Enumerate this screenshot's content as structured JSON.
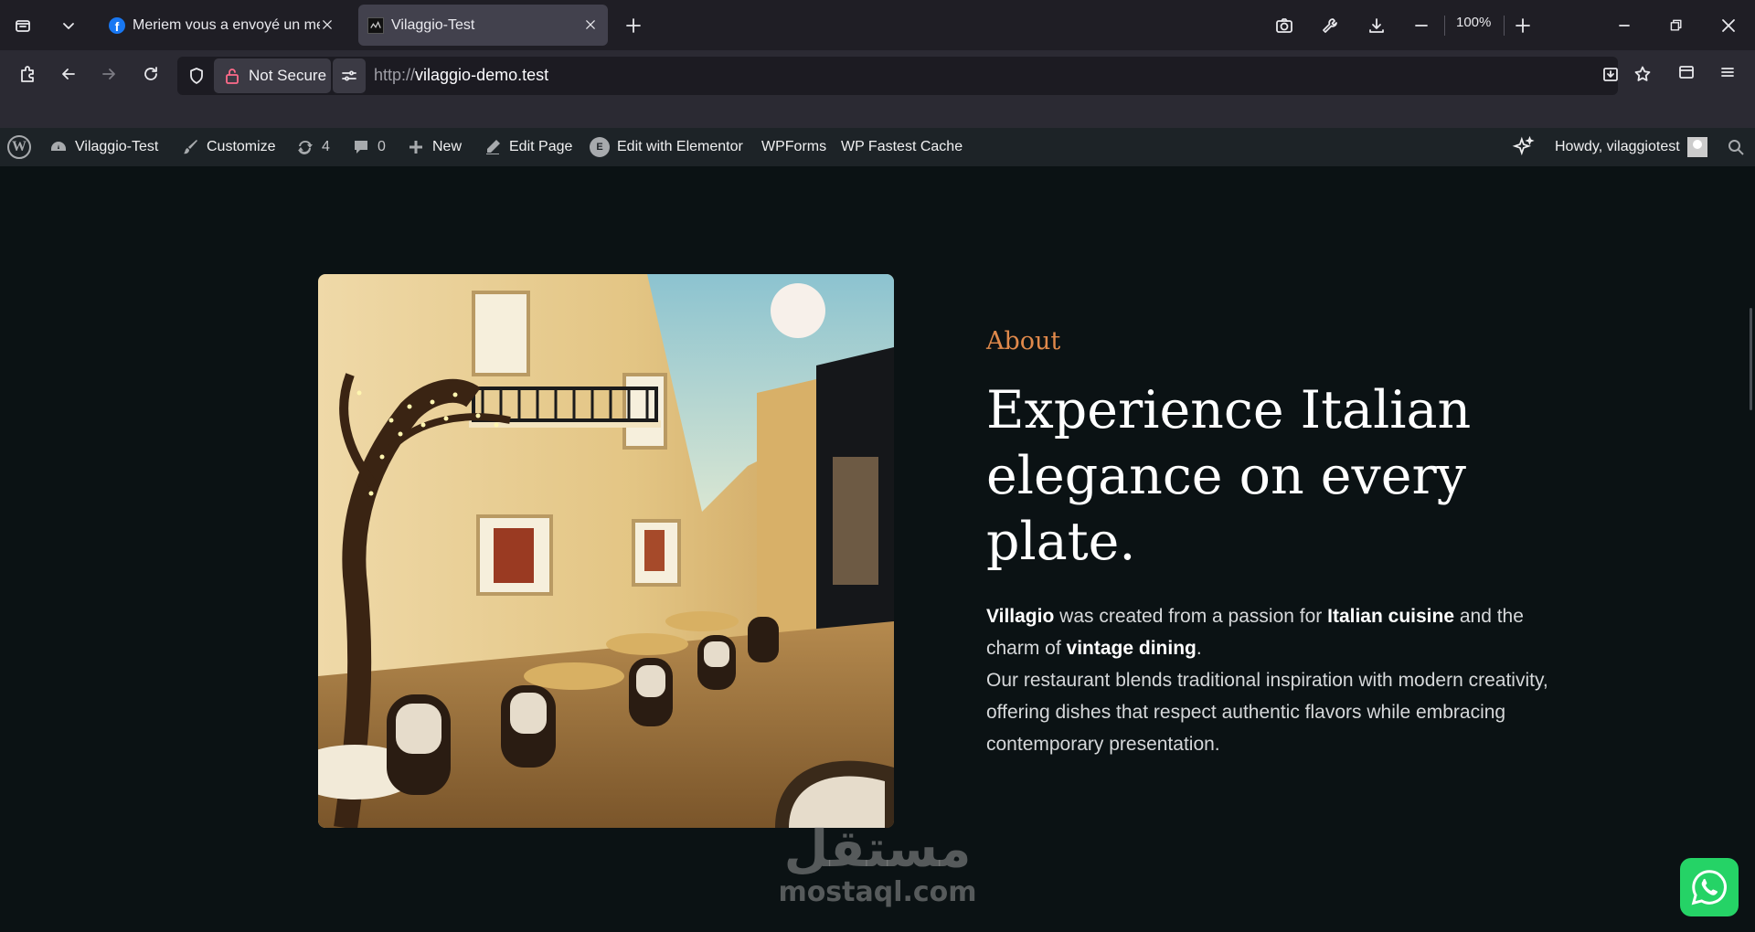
{
  "browser": {
    "tabs": [
      {
        "title": "Meriem vous a envoyé un mess",
        "favicon": "facebook-icon",
        "active": false
      },
      {
        "title": "Vilaggio-Test",
        "favicon": "site-icon",
        "active": true
      }
    ],
    "zoom": "100%",
    "security_label": "Not Secure",
    "url_scheme": "http://",
    "url_host": "vilaggio-demo.test"
  },
  "adminbar": {
    "site_name": "Vilaggio-Test",
    "customize": "Customize",
    "updates_count": "4",
    "comments_count": "0",
    "new": "New",
    "edit_page": "Edit Page",
    "edit_elementor": "Edit with Elementor",
    "wpforms": "WPForms",
    "cache": "WP Fastest Cache",
    "howdy": "Howdy, vilaggiotest"
  },
  "about": {
    "eyebrow": "About",
    "headline": "Experience Italian elegance on every plate.",
    "p1_brand": "Villagio",
    "p1_a": " was created from a passion for ",
    "p1_cuisine": "Italian cuisine",
    "p1_b": " and the charm of ",
    "p1_vintage": "vintage dining",
    "p1_end": ".",
    "p2": "Our restaurant blends traditional inspiration with modern creativity, offering dishes that respect authentic flavors while embracing contemporary presentation."
  },
  "watermark": {
    "arabic": "مستقل",
    "latin": "mostaql.com"
  },
  "colors": {
    "accent": "#e0894b",
    "background": "#0b1214",
    "adminbar": "#1d2327",
    "whatsapp": "#25d366"
  }
}
